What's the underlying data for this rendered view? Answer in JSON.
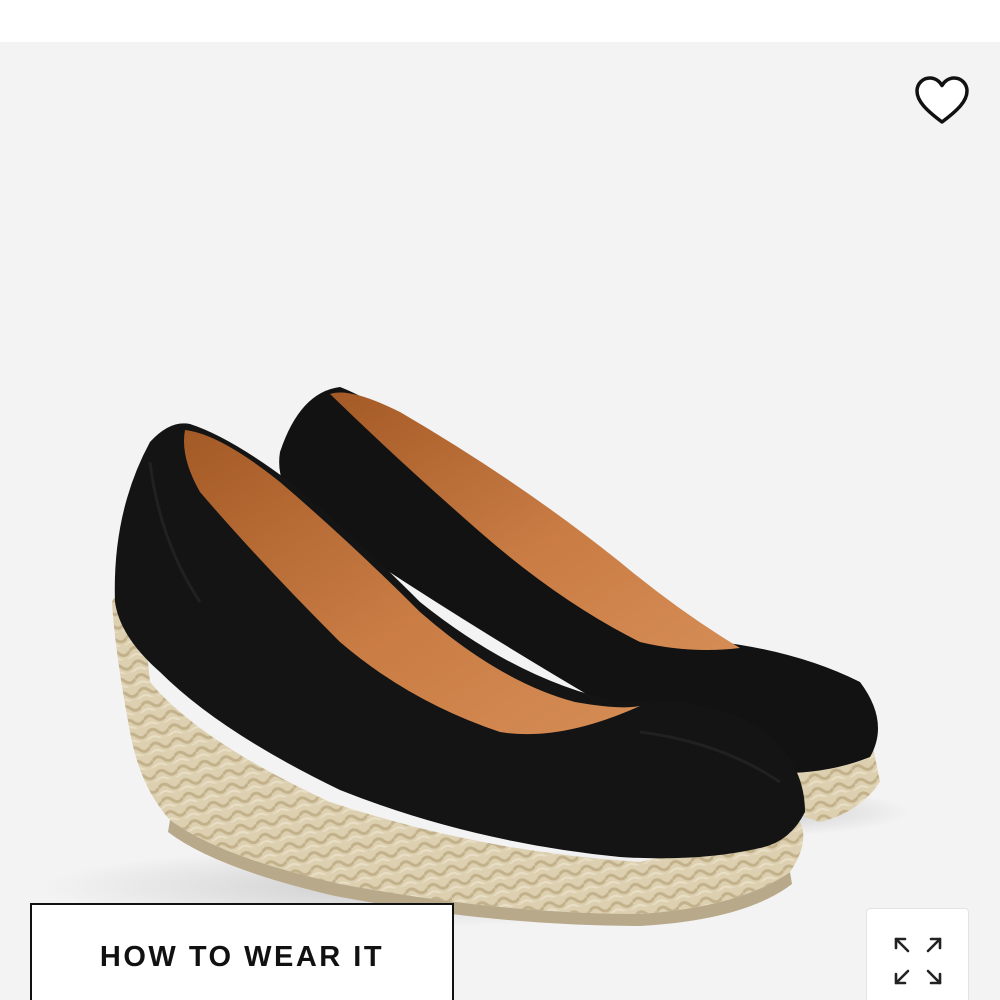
{
  "product": {
    "image_description_icon": "espadrille-wedge-shoes-image",
    "colors": {
      "canvas": "#111111",
      "jute": "#d9cba9",
      "lining": "#b86a32",
      "background": "#f3f3f3"
    }
  },
  "actions": {
    "wishlist_icon": "heart-outline-icon",
    "how_to_wear_label": "HOW TO WEAR IT",
    "expand_icon": "expand-arrows-icon"
  }
}
